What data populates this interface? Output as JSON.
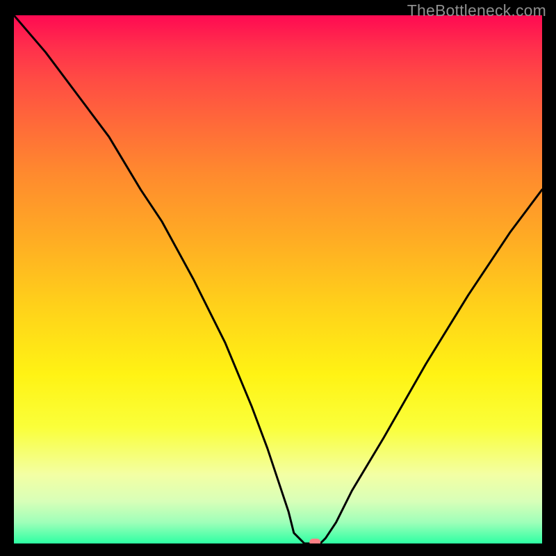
{
  "watermark_text": "TheBottleneck.com",
  "chart_data": {
    "type": "line",
    "title": "",
    "xlabel": "",
    "ylabel": "",
    "xlim": [
      0,
      100
    ],
    "ylim": [
      0,
      100
    ],
    "grid": false,
    "legend": false,
    "annotations": [],
    "series": [
      {
        "name": "bottleneck-curve",
        "x": [
          0,
          6,
          12,
          18,
          24,
          28,
          34,
          40,
          45,
          48,
          50,
          52,
          53,
          55,
          57,
          58,
          59,
          61,
          64,
          70,
          78,
          86,
          94,
          100
        ],
        "y": [
          100,
          93,
          85,
          77,
          67,
          61,
          50,
          38,
          26,
          18,
          12,
          6,
          2,
          0,
          0,
          0,
          1,
          4,
          10,
          20,
          34,
          47,
          59,
          67
        ]
      }
    ],
    "marker": {
      "x": 57,
      "y": 0,
      "shape": "rounded-rect",
      "color": "#ff7f85"
    },
    "gradient_stops": [
      {
        "pos": 0.0,
        "color": "#ff0a52"
      },
      {
        "pos": 0.3,
        "color": "#ff8a2e"
      },
      {
        "pos": 0.68,
        "color": "#fff314"
      },
      {
        "pos": 1.0,
        "color": "#2dffa3"
      }
    ]
  }
}
